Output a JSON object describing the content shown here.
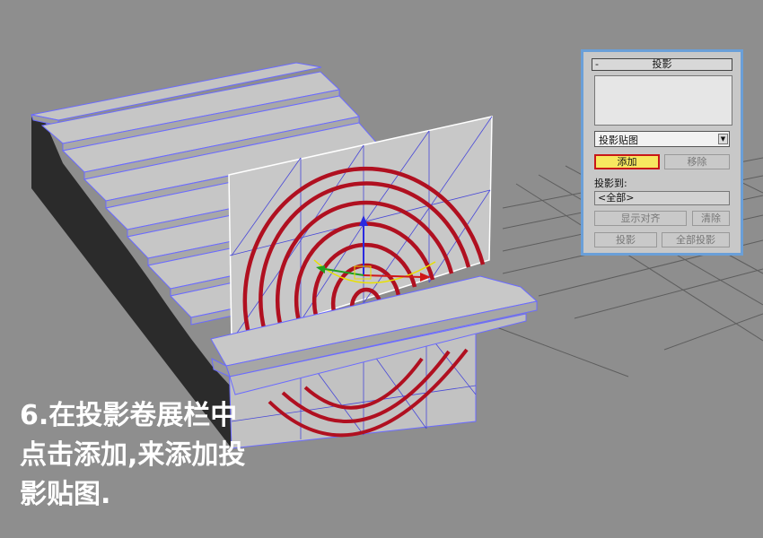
{
  "panel": {
    "title": "投影",
    "collapse_symbol": "-",
    "dropdown_value": "投影贴图",
    "add_label": "添加",
    "remove_label": "移除",
    "project_to_label": "投影到:",
    "project_to_value": "<全部>",
    "show_align_label": "显示对齐",
    "clear_label": "清除",
    "project_label": "投影",
    "project_all_label": "全部投影"
  },
  "caption": {
    "line1": "6.在投影卷展栏中",
    "line2": "点击添加,来添加投",
    "line3": "影贴图."
  },
  "colors": {
    "background": "#8e8e8e",
    "panel_border": "#6a9fd8",
    "highlight_button": "#f7e860",
    "highlight_border": "#c81818",
    "arc": "#b01020",
    "wire": "#4848d8"
  }
}
